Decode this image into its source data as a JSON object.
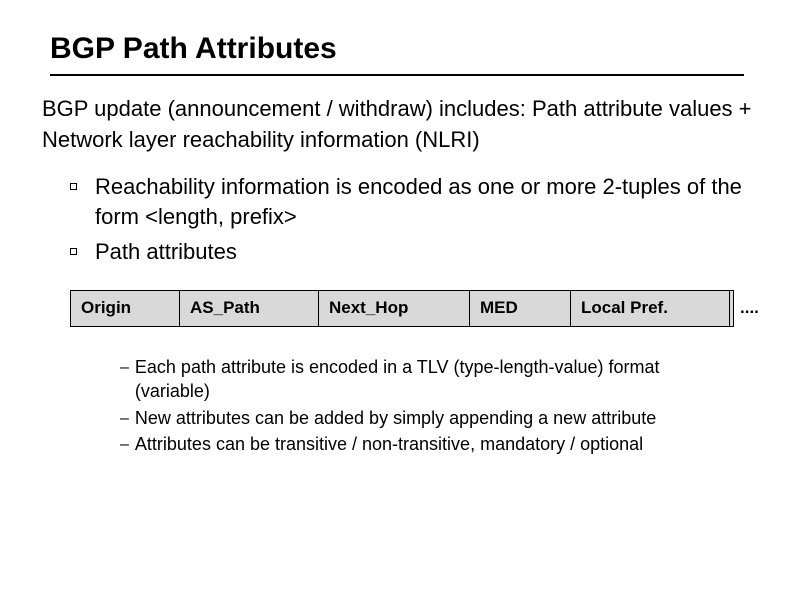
{
  "title": "BGP Path Attributes",
  "intro": "BGP update (announcement / withdraw) includes: Path attribute values + Network layer reachability information (NLRI)",
  "bullets": [
    "Reachability information is encoded as one or more 2-tuples of the form <length, prefix>",
    "Path attributes"
  ],
  "attrs": [
    "Origin",
    "AS_Path",
    "Next_Hop",
    "MED",
    "Local Pref.",
    "...."
  ],
  "dashes": [
    "Each path attribute is encoded in a TLV (type-length-value) format (variable)",
    "New attributes can be added by simply appending a new attribute",
    "Attributes can be transitive / non-transitive, mandatory / optional"
  ]
}
